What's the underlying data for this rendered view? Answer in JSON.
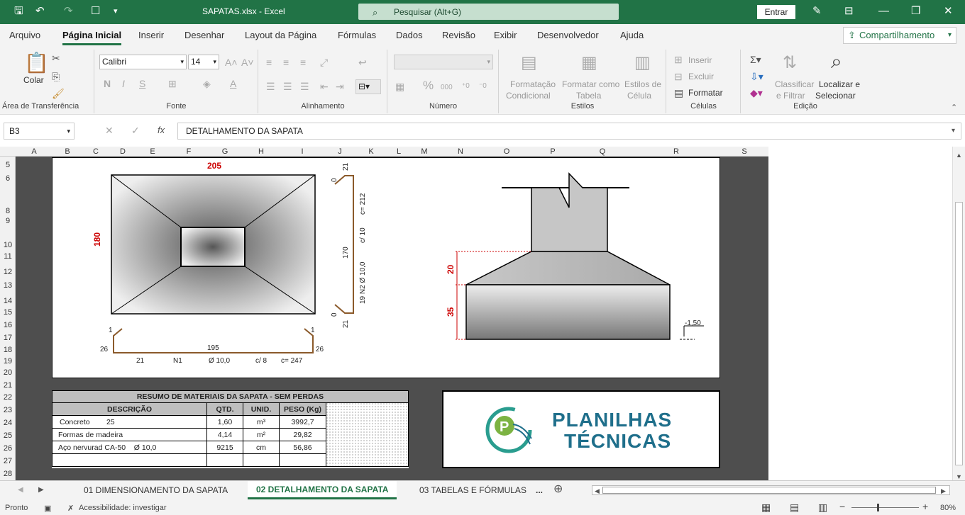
{
  "titlebar": {
    "filename": "SAPATAS.xlsx",
    "sep": "-",
    "app": "Excel",
    "search_placeholder": "Pesquisar (Alt+G)",
    "signin": "Entrar"
  },
  "menu": {
    "items": [
      "Arquivo",
      "Página Inicial",
      "Inserir",
      "Desenhar",
      "Layout da Página",
      "Fórmulas",
      "Dados",
      "Revisão",
      "Exibir",
      "Desenvolvedor",
      "Ajuda"
    ],
    "active": "Página Inicial",
    "share": "Compartilhamento"
  },
  "ribbon": {
    "clipboard": {
      "paste": "Colar",
      "label": "Área de Transferência"
    },
    "font": {
      "name": "Calibri",
      "size": "14",
      "bold": "N",
      "italic": "I",
      "underline": "S",
      "label": "Fonte"
    },
    "alignment": {
      "label": "Alinhamento"
    },
    "number": {
      "format": "",
      "percent": "%",
      "label": "Número"
    },
    "styles": {
      "conditional_1": "Formatação",
      "conditional_2": "Condicional",
      "table_1": "Formatar como",
      "table_2": "Tabela",
      "cell_1": "Estilos de",
      "cell_2": "Célula",
      "label": "Estilos"
    },
    "cells": {
      "insert": "Inserir",
      "delete": "Excluir",
      "format": "Formatar",
      "label": "Células"
    },
    "editing": {
      "sort_1": "Classificar",
      "sort_2": "e Filtrar",
      "find_1": "Localizar e",
      "find_2": "Selecionar",
      "label": "Edição"
    }
  },
  "formula_bar": {
    "cell": "B3",
    "fx": "fx",
    "value": "DETALHAMENTO DA SAPATA"
  },
  "columns": [
    "A",
    "B",
    "C",
    "D",
    "E",
    "F",
    "G",
    "H",
    "I",
    "J",
    "K",
    "L",
    "M",
    "N",
    "O",
    "P",
    "Q",
    "R",
    "S"
  ],
  "rows": [
    "5",
    "6",
    "8",
    "9",
    "10",
    "11",
    "12",
    "13",
    "14",
    "15",
    "16",
    "17",
    "18",
    "19",
    "20",
    "21",
    "22",
    "23",
    "24",
    "25",
    "26",
    "27",
    "28"
  ],
  "drawing": {
    "plan_width": "205",
    "plan_height": "180",
    "bar_top_hook": "21",
    "bar_zero_top": "0",
    "bar_c": "c= 212",
    "bar_spacing": "c/ 10",
    "bar_diam": "19  N2  Ø 10,0",
    "bar_len": "170",
    "bar_zero_bot": "0",
    "bar_bot_hook": "21",
    "n1_hook_l": "1",
    "n1_hook_r": "1",
    "n1_leg_l": "26",
    "n1_leg_r": "26",
    "n1_len": "195",
    "n1_qty": "21",
    "n1_name": "N1",
    "n1_diam": "Ø 10,0",
    "n1_spacing": "c/ 8",
    "n1_c": "c= 247",
    "sec_h1": "20",
    "sec_h2": "35",
    "level": "-1,50"
  },
  "materials": {
    "title": "RESUMO DE MATERIAIS DA SAPATA - SEM PERDAS",
    "headers": [
      "DESCRIÇÃO",
      "QTD.",
      "UNID.",
      "PESO (Kg)"
    ],
    "rows": [
      [
        "Concreto        25",
        "1,60",
        "m³",
        "3992,7"
      ],
      [
        "Formas de madeira",
        "4,14",
        "m²",
        "29,82"
      ],
      [
        "Aço nervurad CA-50    Ø 10,0",
        "9215",
        "cm",
        "56,86"
      ]
    ]
  },
  "logo": {
    "line1": "PLANILHAS",
    "line2": "TÉCNICAS"
  },
  "sheets": {
    "tabs": [
      "01 DIMENSIONAMENTO DA SAPATA",
      "02 DETALHAMENTO DA SAPATA",
      "03 TABELAS E FÓRMULAS"
    ],
    "more": "..."
  },
  "status": {
    "ready": "Pronto",
    "accessibility": "Acessibilidade: investigar",
    "zoom": "80%"
  },
  "colors": {
    "excel_green": "#217346",
    "dim_red": "#cc0000",
    "rebar": "#8b5a2b"
  }
}
